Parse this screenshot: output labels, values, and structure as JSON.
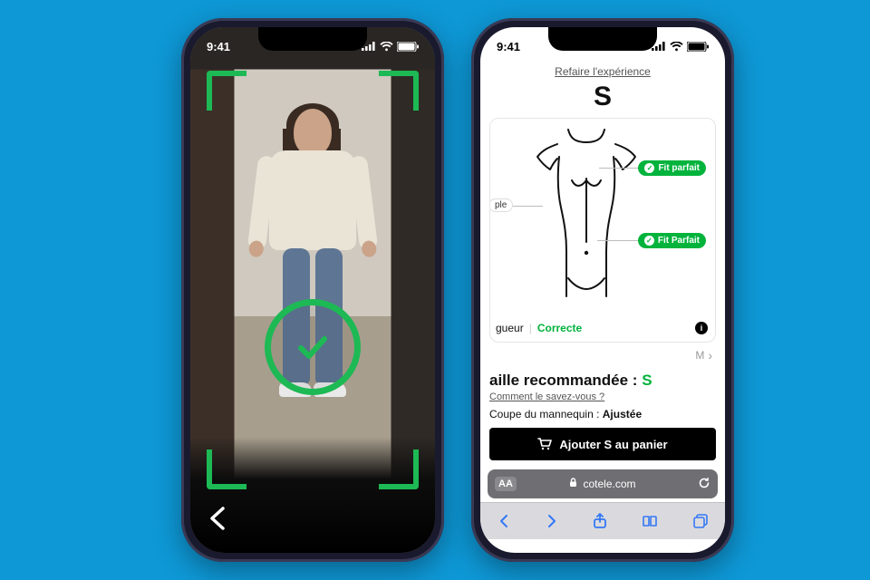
{
  "status": {
    "time": "9:41"
  },
  "camera": {
    "confirm_icon": "checkmark",
    "back_icon": "chevron-left"
  },
  "result": {
    "retry_link": "Refaire l'expérience",
    "size_heading": "S",
    "fit_shoulder": "Fit parfait",
    "fit_hip": "Fit Parfait",
    "chest_tag_fragment": "ple",
    "length_label_fragment": "gueur",
    "length_value": "Correcte",
    "pager_next": "M",
    "reco_label_fragment": "aille recommandée : ",
    "reco_size": "S",
    "how_link": "Comment le savez-vous ?",
    "mannequin_prefix": "Coupe du mannequin : ",
    "mannequin_value": "Ajustée",
    "add_prefix": "Ajouter ",
    "add_size": "S",
    "add_suffix": " au panier",
    "safari": {
      "aa": "AA",
      "lock": "lock-icon",
      "domain": "cotele.com"
    }
  }
}
